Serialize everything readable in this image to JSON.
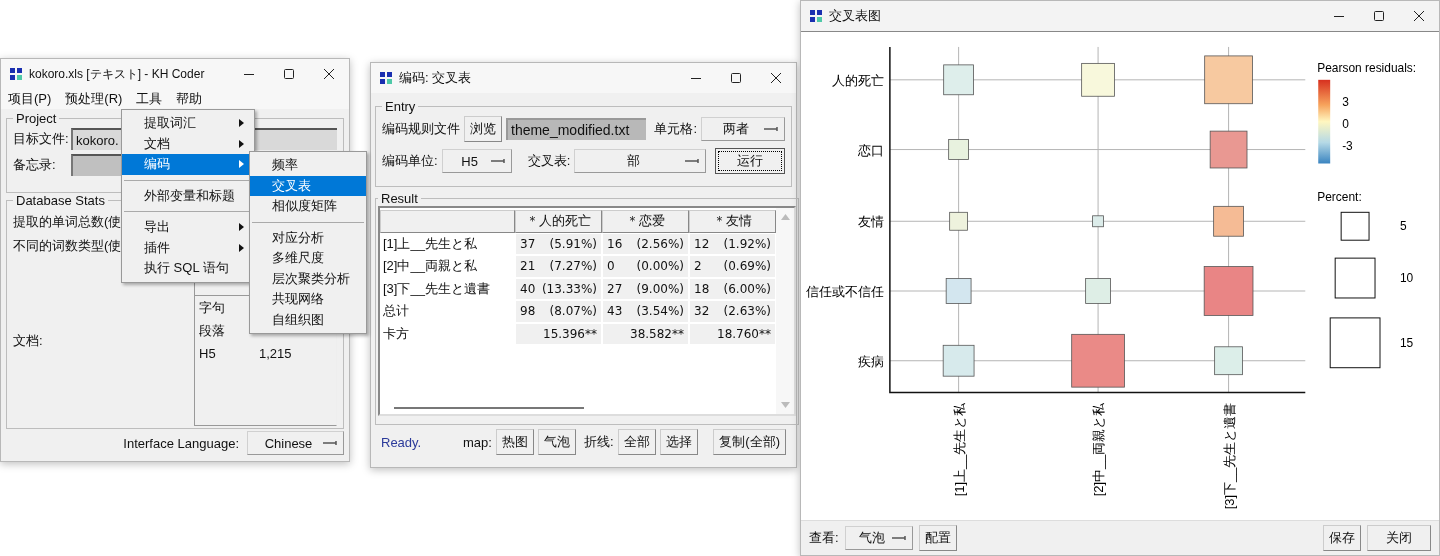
{
  "main_window": {
    "title": "kokoro.xls [テキスト] - KH Coder",
    "menu_bar": [
      {
        "label": "项目(P)"
      },
      {
        "label": "预处理(R)"
      },
      {
        "label": "工具"
      },
      {
        "label": "帮助"
      }
    ],
    "project": {
      "title": "Project",
      "fields": [
        {
          "label": "目标文件:",
          "value": "kokoro."
        },
        {
          "label": "备忘录:"
        }
      ]
    },
    "stats": {
      "title": "Database Stats",
      "labels": [
        "提取的单词总数(使",
        "不同的词数类型(使"
      ],
      "doc_label": "文档:",
      "list": {
        "rows": [
          {
            "label": "字句"
          },
          {
            "label": "段落"
          },
          {
            "label": "H5",
            "value": "1,215"
          }
        ]
      }
    },
    "language": {
      "label": "Interface Language:",
      "value": "Chinese"
    },
    "menu": [
      {
        "kind": "item",
        "label": "提取词汇",
        "submenu": true,
        "selected": false
      },
      {
        "kind": "item",
        "label": "文档",
        "submenu": true,
        "selected": false
      },
      {
        "kind": "item",
        "label": "编码",
        "submenu": true,
        "selected": true
      },
      {
        "kind": "separator"
      },
      {
        "kind": "item",
        "label": "外部变量和标题",
        "submenu": false,
        "selected": false
      },
      {
        "kind": "separator"
      },
      {
        "kind": "item",
        "label": "导出",
        "submenu": true,
        "selected": false
      },
      {
        "kind": "item",
        "label": "插件",
        "submenu": true,
        "selected": false
      },
      {
        "kind": "item",
        "label": "执行 SQL 语句",
        "submenu": false,
        "selected": false
      }
    ],
    "submenu": [
      {
        "kind": "item",
        "label": "频率",
        "selected": false
      },
      {
        "kind": "item",
        "label": "交叉表",
        "selected": true
      },
      {
        "kind": "item",
        "label": "相似度矩阵",
        "selected": false
      },
      {
        "kind": "separator"
      },
      {
        "kind": "item",
        "label": "对应分析",
        "selected": false
      },
      {
        "kind": "item",
        "label": "多维尺度",
        "selected": false
      },
      {
        "kind": "item",
        "label": "层次聚类分析",
        "selected": false
      },
      {
        "kind": "item",
        "label": "共现网络",
        "selected": false
      },
      {
        "kind": "item",
        "label": "自组织图",
        "selected": false
      }
    ]
  },
  "crosstab_window": {
    "title": "编码: 交叉表",
    "entry": {
      "title": "Entry",
      "rule_label": "编码规则文件",
      "browse": "浏览",
      "file": "theme_modified.txt",
      "cell_label": "单元格:",
      "cell_value": "两者",
      "unit_label": "编码单位:",
      "unit_value": "H5",
      "table_label": "交叉表:",
      "table_value": "部",
      "run": {
        "label": "运行",
        "focused": true
      }
    },
    "result": {
      "title": "Result",
      "columns": [
        "＊人的死亡",
        "＊恋爱",
        "＊友情"
      ],
      "rows": [
        {
          "kind": "count",
          "label": "[1]上__先生と私",
          "cells": [
            {
              "count": "37",
              "percent": "(5.91%)"
            },
            {
              "count": "16",
              "percent": "(2.56%)"
            },
            {
              "count": "12",
              "percent": "(1.92%)"
            }
          ]
        },
        {
          "kind": "count",
          "label": "[2]中__両親と私",
          "cells": [
            {
              "count": "21",
              "percent": "(7.27%)"
            },
            {
              "count": "0",
              "percent": "(0.00%)"
            },
            {
              "count": "2",
              "percent": "(0.69%)"
            }
          ]
        },
        {
          "kind": "count",
          "label": "[3]下__先生と遺書",
          "cells": [
            {
              "count": "40",
              "percent": "(13.33%)"
            },
            {
              "count": "27",
              "percent": "(9.00%)"
            },
            {
              "count": "18",
              "percent": "(6.00%)"
            }
          ]
        },
        {
          "kind": "count",
          "label": "总计",
          "cells": [
            {
              "count": "98",
              "percent": "(8.07%)"
            },
            {
              "count": "43",
              "percent": "(3.54%)"
            },
            {
              "count": "32",
              "percent": "(2.63%)"
            }
          ]
        },
        {
          "kind": "stat",
          "label": "卡方",
          "cells": [
            {
              "value": "15.396**"
            },
            {
              "value": "38.582**"
            },
            {
              "value": "18.760**"
            }
          ]
        }
      ]
    },
    "status": "Ready.",
    "map_label": "map:",
    "map_buttons": [
      "热图",
      "气泡"
    ],
    "line_label": "折线:",
    "line_buttons": [
      "全部",
      "选择"
    ],
    "copy": "复制(全部)"
  },
  "chart_window": {
    "title": "交叉表图",
    "chart": {
      "rows": [
        "人的死亡",
        "恋口",
        "友情",
        "信任或不信任",
        "疾病"
      ],
      "columns": [
        "[1]上__先生と私",
        "[2]中__両親と私",
        "[3]下__先生と遺書"
      ],
      "cells": [
        [
          {
            "color": "#deeeeb"
          },
          {
            "color": "#f8f8dc"
          },
          {
            "color": "#f7c9a0"
          }
        ],
        [
          {
            "color": "#e8f2df"
          },
          null,
          {
            "color": "#e99892"
          }
        ],
        [
          {
            "color": "#eef2dd"
          },
          {
            "color": "#dcecea"
          },
          {
            "color": "#f5bb95"
          }
        ],
        [
          {
            "color": "#d3e6ef"
          },
          {
            "color": "#deeee6"
          },
          {
            "color": "#e98585"
          }
        ],
        [
          {
            "color": "#d7eaec"
          },
          {
            "color": "#ea8a87"
          },
          {
            "color": "#dceee9"
          }
        ]
      ],
      "residual_legend": {
        "title": "Pearson residuals:",
        "ticks": [
          "3",
          "0",
          "-3"
        ]
      },
      "size_legend": {
        "title": "Percent:",
        "items": [
          {
            "label": "5"
          },
          {
            "label": "10"
          },
          {
            "label": "15"
          }
        ]
      }
    },
    "view_label": "查看:",
    "view_value": "气泡",
    "config": "配置",
    "save": "保存",
    "close": "关闭"
  }
}
